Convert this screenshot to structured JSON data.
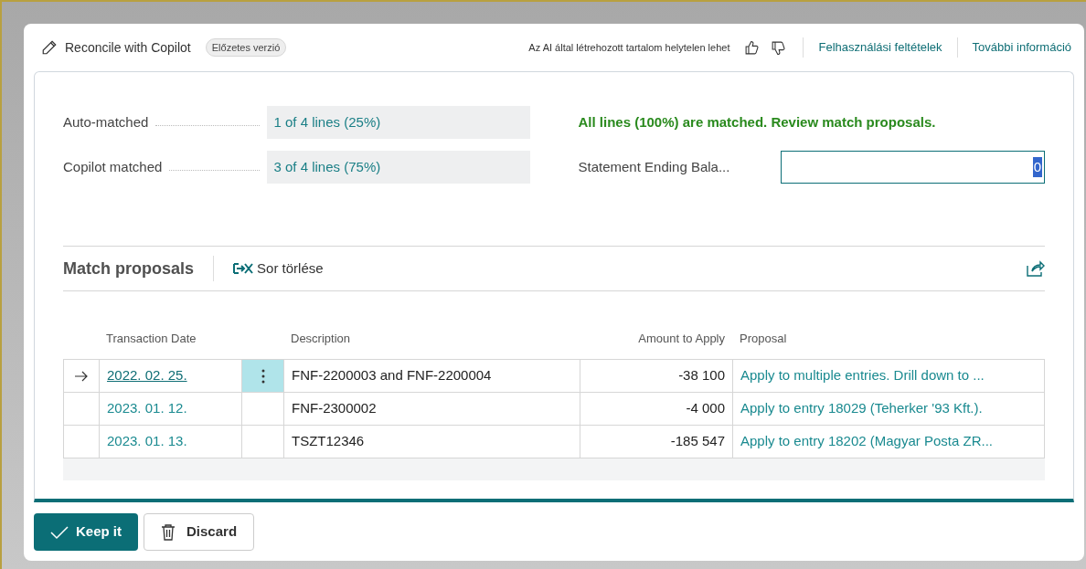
{
  "header": {
    "title": "Reconcile with Copilot",
    "badge": "Előzetes verzió",
    "disclaimer": "Az AI által létrehozott tartalom helytelen lehet",
    "links": [
      "Felhasználási feltételek",
      "További információ"
    ]
  },
  "stats": [
    {
      "label": "Auto-matched",
      "value": "1 of 4 lines (25%)"
    },
    {
      "label": "Copilot matched",
      "value": "3 of 4 lines (75%)"
    }
  ],
  "status_message": "All lines (100%) are matched. Review match proposals.",
  "ending_balance": {
    "label": "Statement Ending Bala...",
    "value": "0"
  },
  "proposals": {
    "title": "Match proposals",
    "action": "Sor törlése",
    "columns": [
      "Transaction Date",
      "Description",
      "Amount to Apply",
      "Proposal"
    ],
    "rows": [
      {
        "selected": true,
        "date": "2022. 02. 25.",
        "description": "FNF-2200003 and FNF-2200004",
        "amount": "-38 100",
        "proposal": "Apply to multiple entries. Drill down to ..."
      },
      {
        "selected": false,
        "date": "2023. 01. 12.",
        "description": "FNF-2300002",
        "amount": "-4 000",
        "proposal": "Apply to entry 18029 (Teherker '93 Kft.)."
      },
      {
        "selected": false,
        "date": "2023. 01. 13.",
        "description": "TSZT12346",
        "amount": "-185 547",
        "proposal": "Apply to entry 18202 (Magyar Posta ZR..."
      }
    ]
  },
  "buttons": [
    "Keep it",
    "Discard"
  ]
}
